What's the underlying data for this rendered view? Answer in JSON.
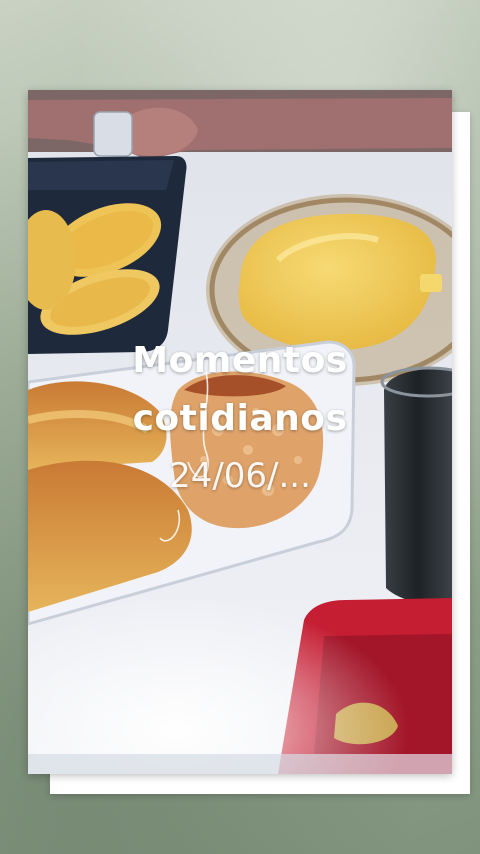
{
  "overlay": {
    "title_line1": "Momentos",
    "title_line2": "cotidianos",
    "date": "24/06/..."
  },
  "colors": {
    "background": "#a9b8a3",
    "frame": "#ffffff",
    "text": "#ffffff",
    "tablecloth": "#e6e8ee",
    "corn_bowl": "#1e2a3c",
    "cake": "#e0a24a",
    "pudding": "#f2cf5e",
    "red_container": "#c51d32"
  }
}
